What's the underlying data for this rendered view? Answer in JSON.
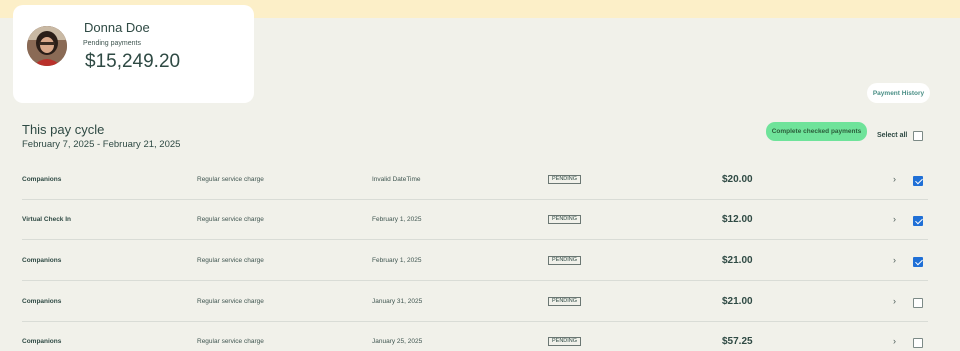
{
  "profile": {
    "name": "Donna Doe",
    "pending_label": "Pending payments",
    "pending_amount": "$15,249.20"
  },
  "actions": {
    "payment_history": "Payment History",
    "complete_checked": "Complete checked payments",
    "select_all": "Select all",
    "select_all_checked": false
  },
  "cycle": {
    "title": "This pay cycle",
    "range": "February 7, 2025 - February 21, 2025"
  },
  "payments": [
    {
      "name": "Companions",
      "type": "Regular service charge",
      "date": "Invalid DateTime",
      "status": "PENDING",
      "amount": "$20.00",
      "checked": true
    },
    {
      "name": "Virtual Check In",
      "type": "Regular service charge",
      "date": "February 1, 2025",
      "status": "PENDING",
      "amount": "$12.00",
      "checked": true
    },
    {
      "name": "Companions",
      "type": "Regular service charge",
      "date": "February 1, 2025",
      "status": "PENDING",
      "amount": "$21.00",
      "checked": true
    },
    {
      "name": "Companions",
      "type": "Regular service charge",
      "date": "January 31, 2025",
      "status": "PENDING",
      "amount": "$21.00",
      "checked": false
    },
    {
      "name": "Companions",
      "type": "Regular service charge",
      "date": "January 25, 2025",
      "status": "PENDING",
      "amount": "$57.25",
      "checked": false
    }
  ],
  "icons": {
    "chevron": "chevron-right-icon",
    "avatar": "user-photo"
  },
  "colors": {
    "banner": "#fcefc8",
    "background": "#f1f1ea",
    "accent_green": "#6fe39a",
    "checkbox_blue": "#1f6fd6",
    "history_text": "#4a8f86"
  }
}
